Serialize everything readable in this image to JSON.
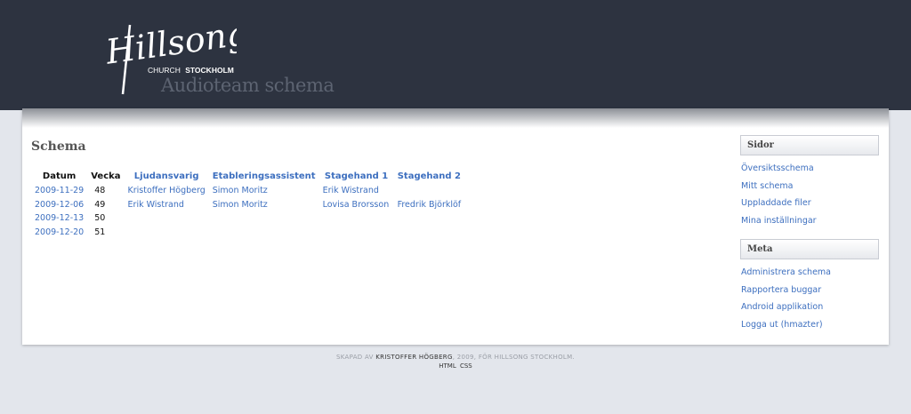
{
  "header": {
    "logo_text": "Hillsong",
    "logo_sub_prefix": "CHURCH",
    "logo_sub_strong": "STOCKHOLM",
    "site_title": "Audioteam schema"
  },
  "main": {
    "heading": "Schema",
    "columns": [
      "Datum",
      "Vecka",
      "Ljudansvarig",
      "Etableringsassistent",
      "Stagehand 1",
      "Stagehand 2"
    ],
    "rows": [
      {
        "date": "2009-11-29",
        "week": "48",
        "ljud": "Kristoffer Högberg",
        "etab": "Simon Moritz",
        "sh1": "Erik Wistrand",
        "sh2": ""
      },
      {
        "date": "2009-12-06",
        "week": "49",
        "ljud": "Erik Wistrand",
        "etab": "Simon Moritz",
        "sh1": "Lovisa Brorsson",
        "sh2": "Fredrik Björklöf"
      },
      {
        "date": "2009-12-13",
        "week": "50",
        "ljud": "",
        "etab": "",
        "sh1": "",
        "sh2": ""
      },
      {
        "date": "2009-12-20",
        "week": "51",
        "ljud": "",
        "etab": "",
        "sh1": "",
        "sh2": ""
      }
    ]
  },
  "sidebar": {
    "pages_title": "Sidor",
    "pages": [
      {
        "label": "Översiktsschema"
      },
      {
        "label": "Mitt schema"
      },
      {
        "label": "Uppladdade filer"
      },
      {
        "label": "Mina inställningar"
      }
    ],
    "meta_title": "Meta",
    "meta": [
      {
        "label": "Administrera schema"
      },
      {
        "label": "Rapportera buggar"
      },
      {
        "label": "Android applikation"
      },
      {
        "label": "Logga ut (hmazter)"
      }
    ]
  },
  "footer": {
    "prefix": "Skapad av",
    "author": "Kristoffer Högberg",
    "suffix": ", 2009, för Hillsong Stockholm.",
    "link_html": "HTML",
    "link_css": "CSS"
  },
  "colors": {
    "header_bg": "#2d3340",
    "link": "#3d6fbf",
    "page_bg": "#e3e6ec"
  }
}
